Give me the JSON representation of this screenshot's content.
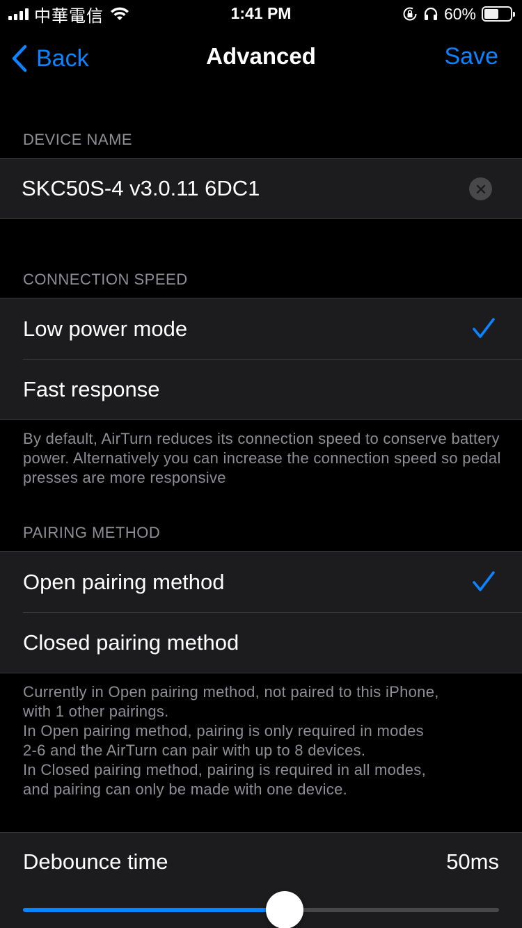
{
  "status_bar": {
    "carrier": "中華電信",
    "time": "1:41 PM",
    "battery_percent": "60%",
    "battery_level": 0.6
  },
  "nav": {
    "back_label": "Back",
    "title": "Advanced",
    "save_label": "Save"
  },
  "device_name": {
    "header": "DEVICE NAME",
    "value": "SKC50S-4 v3.0.11 6DC1"
  },
  "connection_speed": {
    "header": "CONNECTION SPEED",
    "options": [
      {
        "label": "Low power mode",
        "selected": true
      },
      {
        "label": "Fast response",
        "selected": false
      }
    ],
    "footer": "By default, AirTurn reduces its connection speed to conserve battery power. Alternatively you can increase the connection speed so pedal presses are more responsive"
  },
  "pairing_method": {
    "header": "PAIRING METHOD",
    "options": [
      {
        "label": "Open pairing method",
        "selected": true
      },
      {
        "label": "Closed pairing method",
        "selected": false
      }
    ],
    "footer_lines": [
      "Currently in Open pairing method, not paired to this iPhone,",
      "with 1 other pairings.",
      "In Open pairing method, pairing is only required in modes",
      "2-6 and the AirTurn can pair with up to 8 devices.",
      "In Closed pairing method, pairing is required in all modes,",
      "and pairing can only be made with one device."
    ]
  },
  "debounce": {
    "label": "Debounce time",
    "value": "50ms",
    "slider_fraction": 0.55
  },
  "colors": {
    "accent": "#0a84ff",
    "background": "#000000",
    "cell": "#1c1c1e",
    "secondary_text": "#8e8e93"
  }
}
